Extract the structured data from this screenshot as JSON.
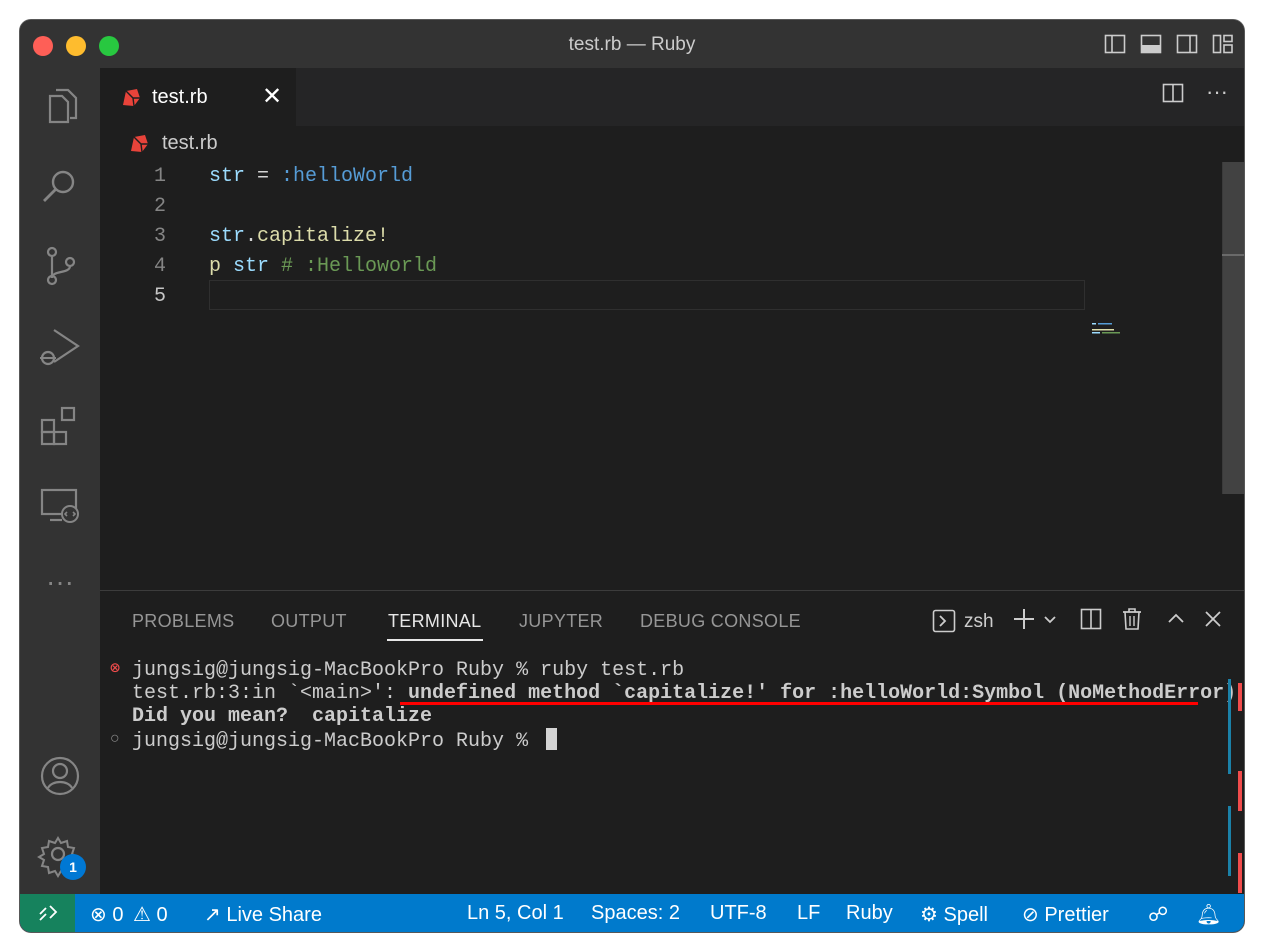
{
  "window": {
    "title": "test.rb — Ruby"
  },
  "activity_bar": {
    "badge_count": "1"
  },
  "tabs": [
    {
      "label": "test.rb"
    }
  ],
  "breadcrumb": {
    "file": "test.rb"
  },
  "editor": {
    "lines": [
      {
        "number": "1"
      },
      {
        "number": "2"
      },
      {
        "number": "3"
      },
      {
        "number": "4"
      },
      {
        "number": "5"
      }
    ],
    "tokens": {
      "l1_var": "str",
      "l1_op": " = ",
      "l1_sym": ":helloWorld",
      "l3_var": "str",
      "l3_dot": ".",
      "l3_fn": "capitalize!",
      "l4_fn": "p",
      "l4_var": " str",
      "l4_cm": " # :Helloworld"
    }
  },
  "panel": {
    "tabs": [
      "PROBLEMS",
      "OUTPUT",
      "TERMINAL",
      "JUPYTER",
      "DEBUG CONSOLE"
    ],
    "active_tab": "TERMINAL",
    "shell": "zsh"
  },
  "terminal": {
    "line1": "jungsig@jungsig-MacBookPro Ruby % ruby test.rb",
    "line2_prefix": "test.rb:3:in `<main>': ",
    "line2_error": "undefined method `capitalize!' for :helloWorld:Symbol (NoMethodError)",
    "line3": "Did you mean?  capitalize",
    "line4": "jungsig@jungsig-MacBookPro Ruby % "
  },
  "statusbar": {
    "errors": "0",
    "warnings": "0",
    "live_share": "Live Share",
    "position": "Ln 5, Col 1",
    "spaces": "Spaces: 2",
    "encoding": "UTF-8",
    "eol": "LF",
    "language": "Ruby",
    "spell": "Spell",
    "prettier": "Prettier"
  },
  "colors": {
    "statusbar": "#007acc",
    "remote": "#16825d",
    "error": "#f14c4c",
    "ruby_icon": "#e8433a"
  },
  "icons": [
    "explorer-icon",
    "search-icon",
    "source-control-icon",
    "run-debug-icon",
    "extensions-icon",
    "remote-explorer-icon",
    "more-icon",
    "account-icon",
    "settings-gear-icon",
    "ruby-file-icon",
    "close-icon",
    "split-editor-icon",
    "more-actions-icon",
    "terminal-icon",
    "plus-icon",
    "chevron-down-icon",
    "trash-icon",
    "chevron-up-icon",
    "remote-icon",
    "error-icon",
    "warning-icon",
    "live-share-icon",
    "feedback-icon",
    "bell-icon"
  ]
}
